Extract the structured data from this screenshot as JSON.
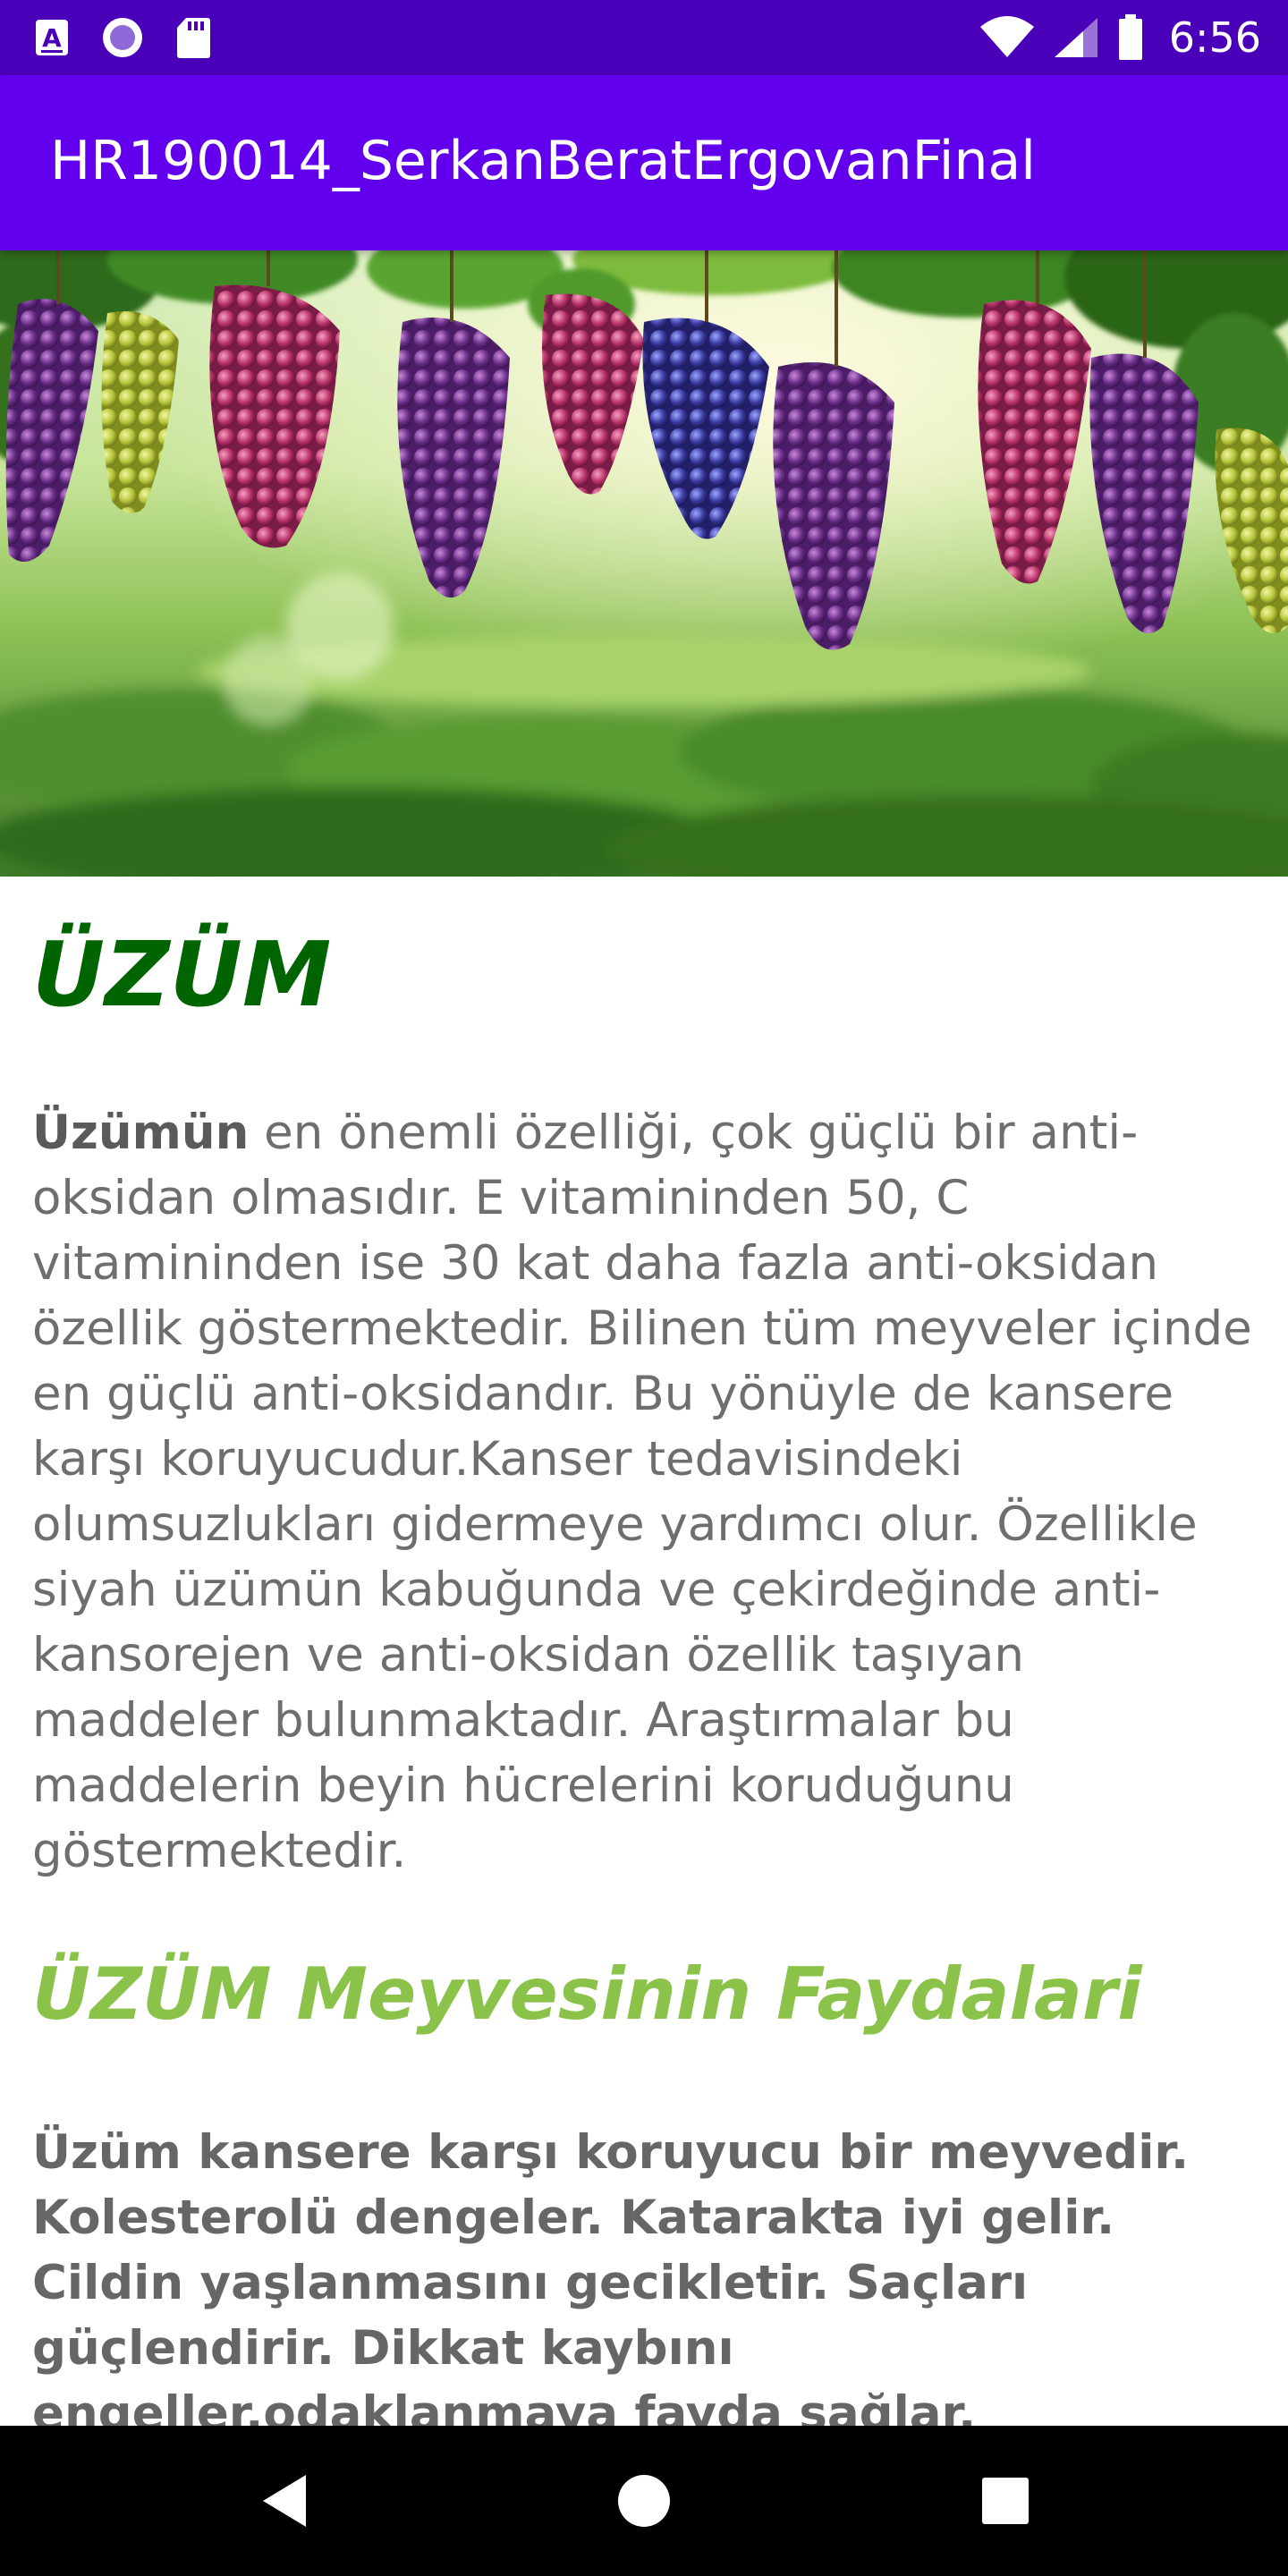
{
  "status_bar": {
    "time": "6:56",
    "icons": [
      "a-accessibility-icon",
      "circle-record-icon",
      "sd-card-icon",
      "wifi-icon",
      "cell-signal-icon",
      "battery-icon"
    ]
  },
  "app_bar": {
    "title": "HR190014_SerkanBeratErgovanFinal",
    "color": "#6200ee",
    "status_color": "#4a00b8"
  },
  "hero": {
    "image": "grapes-vineyard-image"
  },
  "main": {
    "title": "ÜZÜM",
    "title_color": "#006400",
    "intro_bold": "Üzümün",
    "intro_text": " en önemli özelliği, çok güçlü bir anti-oksidan olmasıdır. E vitamininden 50, C vitamininden ise 30 kat daha fazla anti-oksidan özellik göstermektedir. Bilinen tüm meyveler içinde en güçlü anti-oksidandır. Bu yönüyle de kansere karşı koruyucudur.Kanser tedavisindeki olumsuzlukları gidermeye yardımcı olur. Özellikle siyah üzümün kabuğunda ve çekirdeğinde anti- kansorejen ve anti-oksidan özellik taşıyan maddeler bulunmaktadır. Araştırmalar bu maddelerin beyin hücrelerini koruduğunu göstermektedir.",
    "subtitle": "ÜZÜM Meyvesinin Faydalari",
    "subtitle_color": "#8bc34a",
    "benefits": "Üzüm kansere karşı koruyucu bir meyvedir. Kolesterolü dengeler. Katarakta iyi gelir. Cildin yaşlanmasını gecikletir. Saçları güçlendirir. Dikkat kaybını engeller,odaklanmaya fayda sağlar."
  },
  "nav_bar": {
    "buttons": [
      "back-icon",
      "home-icon",
      "recents-icon"
    ]
  }
}
